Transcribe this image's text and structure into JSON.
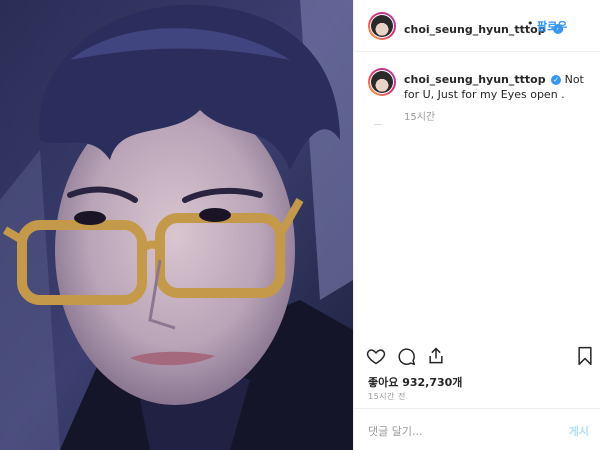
{
  "post": {
    "username": "choi_seung_hyun_tttop",
    "verified_icon": "verified-badge-icon",
    "follow_label": "팔로우",
    "separator": "•",
    "caption_username": "choi_seung_hyun_tttop",
    "caption_text": "Not for U, Just for my Eyes open .",
    "caption_time": "15시간",
    "likes_label": "좋아요 932,730개",
    "post_time": "15시간 전",
    "comment_placeholder": "댓글 달기...",
    "post_button_label": "게시"
  },
  "icons": {
    "like": "heart-icon",
    "comment": "comment-icon",
    "share": "share-icon",
    "save": "bookmark-icon"
  },
  "colors": {
    "accent": "#3897f0",
    "text": "#262626",
    "muted": "#999999",
    "border": "#efefef"
  }
}
